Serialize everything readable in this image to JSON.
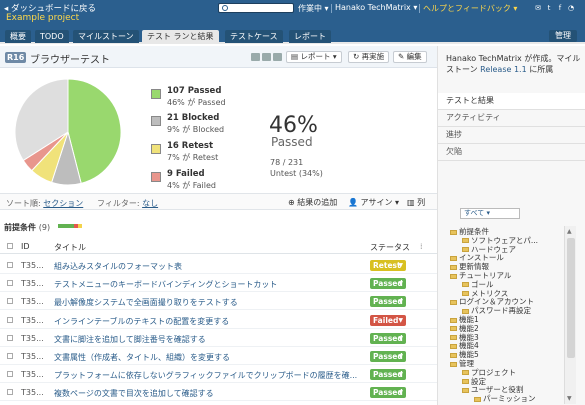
{
  "topbar": {
    "back_label": "ダッシュボードに戻る",
    "project": "Example project",
    "work_menu": "作業中 ▾",
    "user_menu": "Hanako TechMatrix ▾",
    "help_menu": "ヘルプとフィードバック ▾"
  },
  "nav": {
    "tabs": [
      "概要",
      "TODO",
      "マイルストーン",
      "テスト ランと結果",
      "テストケース",
      "レポート"
    ],
    "manage": "管理"
  },
  "run": {
    "id_badge": "R16",
    "title": "ブラウザーテスト",
    "report_btn": "レポート ▾",
    "rerun_btn": "再実施",
    "edit_btn": "編集"
  },
  "summary": {
    "legend": [
      {
        "title": "107 Passed",
        "sub": "46% が Passed",
        "color": "#99d86e"
      },
      {
        "title": "21 Blocked",
        "sub": "9% が Blocked",
        "color": "#bdbdbd"
      },
      {
        "title": "16 Retest",
        "sub": "7% が Retest",
        "color": "#f0e27a"
      },
      {
        "title": "9 Failed",
        "sub": "4% が Failed",
        "color": "#e8968d"
      }
    ],
    "percent": "46%",
    "percent_label": "Passed",
    "count": "78 / 231",
    "untested": "Untest (34%)"
  },
  "chart_data": {
    "type": "pie",
    "categories": [
      "Passed",
      "Blocked",
      "Retest",
      "Failed",
      "Untested"
    ],
    "values": [
      46,
      9,
      7,
      4,
      34
    ],
    "colors": [
      "#99d86e",
      "#bdbdbd",
      "#f0e27a",
      "#e8968d",
      "#dedede"
    ]
  },
  "filter": {
    "sort_prefix": "ソート順:",
    "sort_value": "セクション",
    "filter_prefix": "フィルター:",
    "filter_value": "なし",
    "add_result": "結果の追加",
    "assign": "アサイン ▾",
    "columns": "列"
  },
  "section": {
    "title": "前提条件",
    "count": "(9)"
  },
  "table": {
    "headers": [
      "ID",
      "タイトル",
      "ステータス"
    ],
    "rows": [
      {
        "id": "T35...",
        "title": "組み込みスタイルのフォーマット表",
        "status": "Retest",
        "color": "#d8c021"
      },
      {
        "id": "T35...",
        "title": "テストメニューのキーボードバインディングとショートカット",
        "status": "Passed",
        "color": "#62b251"
      },
      {
        "id": "T35...",
        "title": "最小解像度システムで全画面撮り取りをテストする",
        "status": "Passed",
        "color": "#62b251"
      },
      {
        "id": "T35...",
        "title": "インラインテーブルのテキストの配置を変更する",
        "status": "Failed",
        "color": "#d35545"
      },
      {
        "id": "T35...",
        "title": "文書に脚注を追加して脚注番号を確認する",
        "status": "Passed",
        "color": "#62b251"
      },
      {
        "id": "T35...",
        "title": "文書属性（作成者、タイトル、組織）を変更する",
        "status": "Passed",
        "color": "#62b251"
      },
      {
        "id": "T35...",
        "title": "プラットフォームに依存しないグラフィックファイルでクリップボードの履歴を確...",
        "status": "Passed",
        "color": "#62b251"
      },
      {
        "id": "T35...",
        "title": "複数ページの文書で目次を追加して確認する",
        "status": "Passed",
        "color": "#62b251"
      }
    ]
  },
  "sidebar": {
    "info_prefix": "Hanako TechMatrix が作成。マイルストーン",
    "info_link": "Release 1.1",
    "info_suffix": "に所属",
    "tabs": [
      "テストと結果",
      "アクティビティ",
      "進捗",
      "欠陥"
    ],
    "select_value": "すべて ▾",
    "tree": [
      {
        "label": "前提条件",
        "depth": 0
      },
      {
        "label": "ソフトウェアとパ...",
        "depth": 1
      },
      {
        "label": "ハードウェア",
        "depth": 1
      },
      {
        "label": "インストール",
        "depth": 0
      },
      {
        "label": "更新情報",
        "depth": 0
      },
      {
        "label": "チュートリアル",
        "depth": 0
      },
      {
        "label": "ゴール",
        "depth": 1
      },
      {
        "label": "メトリクス",
        "depth": 1
      },
      {
        "label": "ログイン＆アカウント",
        "depth": 0
      },
      {
        "label": "パスワード再設定",
        "depth": 1
      },
      {
        "label": "機能1",
        "depth": 0
      },
      {
        "label": "機能2",
        "depth": 0
      },
      {
        "label": "機能3",
        "depth": 0
      },
      {
        "label": "機能4",
        "depth": 0
      },
      {
        "label": "機能5",
        "depth": 0
      },
      {
        "label": "管理",
        "depth": 0
      },
      {
        "label": "プロジェクト",
        "depth": 1
      },
      {
        "label": "設定",
        "depth": 1
      },
      {
        "label": "ユーザーと役割",
        "depth": 1
      },
      {
        "label": "パーミッション",
        "depth": 2
      }
    ]
  }
}
